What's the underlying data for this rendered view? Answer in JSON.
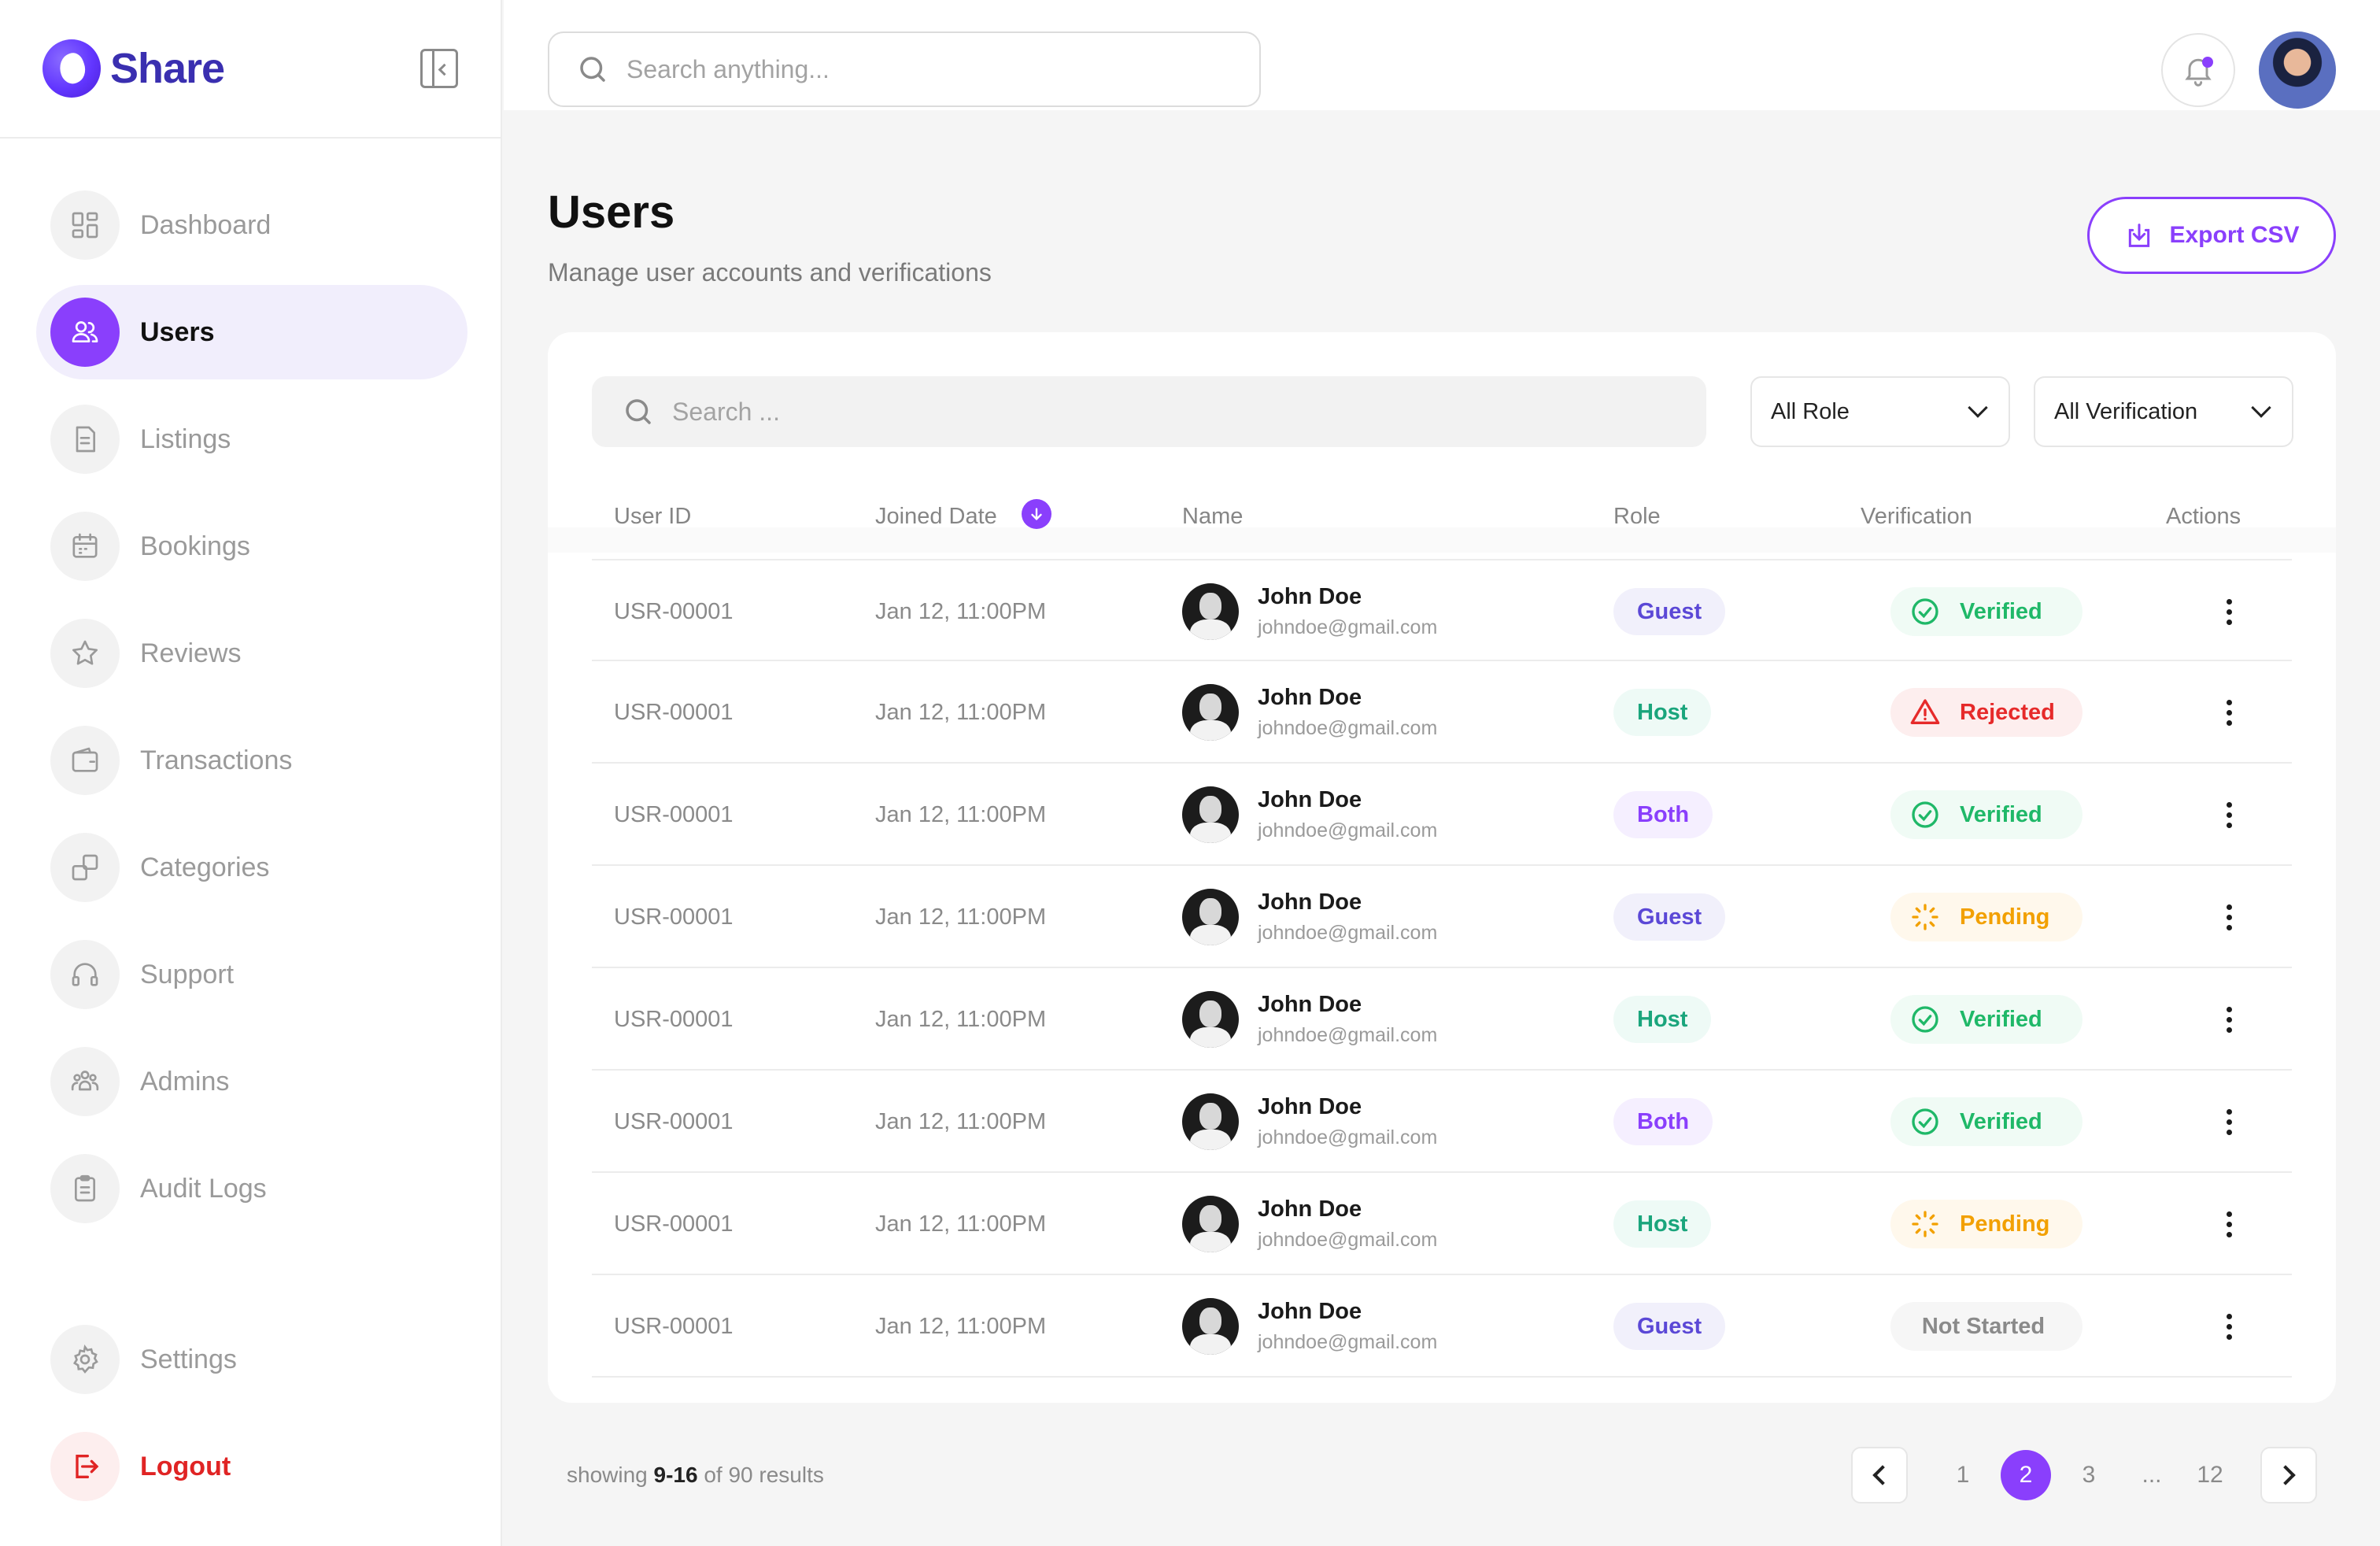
{
  "brand": {
    "name": "Share"
  },
  "sidebar": {
    "items": [
      {
        "label": "Dashboard",
        "icon": "dashboard-icon"
      },
      {
        "label": "Users",
        "icon": "users-icon",
        "active": true
      },
      {
        "label": "Listings",
        "icon": "listings-icon"
      },
      {
        "label": "Bookings",
        "icon": "calendar-icon"
      },
      {
        "label": "Reviews",
        "icon": "star-icon"
      },
      {
        "label": "Transactions",
        "icon": "wallet-icon"
      },
      {
        "label": "Categories",
        "icon": "categories-icon"
      },
      {
        "label": "Support",
        "icon": "headset-icon"
      },
      {
        "label": "Admins",
        "icon": "admins-icon"
      },
      {
        "label": "Audit Logs",
        "icon": "clipboard-icon"
      }
    ],
    "settings_label": "Settings",
    "logout_label": "Logout"
  },
  "topbar": {
    "search_placeholder": "Search anything..."
  },
  "page": {
    "title": "Users",
    "subtitle": "Manage user accounts and verifications",
    "export_label": "Export CSV"
  },
  "filters": {
    "search_placeholder": "Search ...",
    "role_value": "All Role",
    "verification_value": "All Verification"
  },
  "table": {
    "headers": {
      "user_id": "User ID",
      "joined_date": "Joined Date",
      "name": "Name",
      "role": "Role",
      "verification": "Verification",
      "actions": "Actions"
    },
    "rows": [
      {
        "id": "USR-00001",
        "date": "Jan 12, 11:00PM",
        "name": "John Doe",
        "email": "johndoe@gmail.com",
        "role": "Guest",
        "verification": "Verified"
      },
      {
        "id": "USR-00001",
        "date": "Jan 12, 11:00PM",
        "name": "John Doe",
        "email": "johndoe@gmail.com",
        "role": "Host",
        "verification": "Rejected"
      },
      {
        "id": "USR-00001",
        "date": "Jan 12, 11:00PM",
        "name": "John Doe",
        "email": "johndoe@gmail.com",
        "role": "Both",
        "verification": "Verified"
      },
      {
        "id": "USR-00001",
        "date": "Jan 12, 11:00PM",
        "name": "John Doe",
        "email": "johndoe@gmail.com",
        "role": "Guest",
        "verification": "Pending"
      },
      {
        "id": "USR-00001",
        "date": "Jan 12, 11:00PM",
        "name": "John Doe",
        "email": "johndoe@gmail.com",
        "role": "Host",
        "verification": "Verified"
      },
      {
        "id": "USR-00001",
        "date": "Jan 12, 11:00PM",
        "name": "John Doe",
        "email": "johndoe@gmail.com",
        "role": "Both",
        "verification": "Verified"
      },
      {
        "id": "USR-00001",
        "date": "Jan 12, 11:00PM",
        "name": "John Doe",
        "email": "johndoe@gmail.com",
        "role": "Host",
        "verification": "Pending"
      },
      {
        "id": "USR-00001",
        "date": "Jan 12, 11:00PM",
        "name": "John Doe",
        "email": "johndoe@gmail.com",
        "role": "Guest",
        "verification": "Not Started"
      }
    ]
  },
  "pagination": {
    "showing_prefix": "showing",
    "showing_range": "9-16",
    "showing_suffix": "of 90 results",
    "pages": [
      "1",
      "2",
      "3",
      "...",
      "12"
    ],
    "current": "2"
  },
  "colors": {
    "accent": "#8a3ffc",
    "verified": "#1fb868",
    "rejected": "#e62a2a",
    "pending": "#f2a000"
  }
}
